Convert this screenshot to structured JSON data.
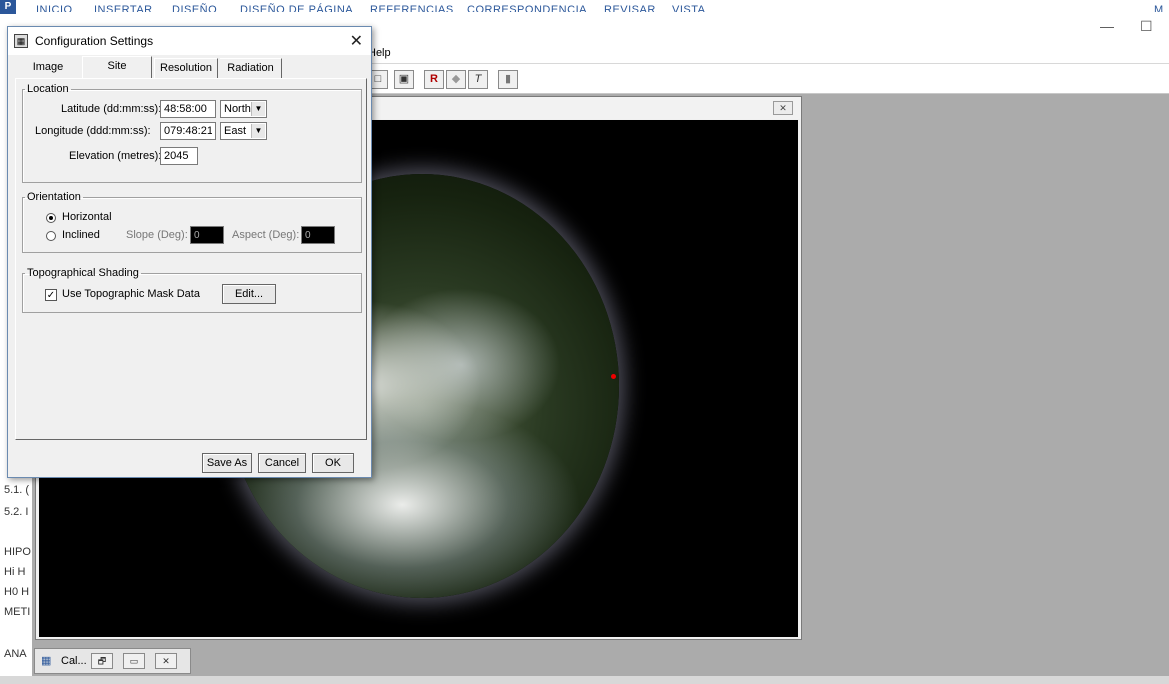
{
  "word_ribbon": {
    "icon": "P",
    "tabs": [
      "INICIO",
      "INSERTAR",
      "DISEÑO",
      "DISEÑO DE PÁGINA",
      "REFERENCIAS",
      "CORRESPONDENCIA",
      "REVISAR",
      "VISTA"
    ],
    "right_text": "M"
  },
  "word_left_strip": [
    "5.1. (",
    "5.2. I",
    "HIPO",
    "Hi H",
    "H0 H",
    "METI",
    "ANA"
  ],
  "app": {
    "menu_help": "Help",
    "minimize": "—",
    "maximize": "☐",
    "toolbar_icons": [
      "open-icon",
      "properties-icon",
      "red-tool-icon",
      "gray-tool-icon",
      "text-tool-icon",
      "bar-icon"
    ]
  },
  "image_window": {
    "close_glyph": "✕"
  },
  "minimized_child": {
    "label": "Cal...",
    "restore": "🗗",
    "maximize": "▭",
    "close": "✕"
  },
  "dialog": {
    "title": "Configuration Settings",
    "close": "✕",
    "tabs": [
      "Image",
      "Site",
      "Resolution",
      "Radiation"
    ],
    "active_tab": "Site",
    "location": {
      "legend": "Location",
      "latitude_label": "Latitude (dd:mm:ss):",
      "latitude_value": "48:58:00",
      "latitude_dir": "North",
      "longitude_label": "Longitude (ddd:mm:ss):",
      "longitude_value": "079:48:21",
      "longitude_dir": "East",
      "elevation_label": "Elevation (metres):",
      "elevation_value": "2045"
    },
    "orientation": {
      "legend": "Orientation",
      "horizontal": "Horizontal",
      "inclined": "Inclined",
      "slope_label": "Slope (Deg):",
      "slope_value": "0",
      "aspect_label": "Aspect (Deg):",
      "aspect_value": "0",
      "selected": "Horizontal"
    },
    "topo": {
      "legend": "Topographical Shading",
      "use_mask": "Use Topographic Mask Data",
      "use_mask_checked": true,
      "edit": "Edit..."
    },
    "buttons": {
      "save_as": "Save As",
      "cancel": "Cancel",
      "ok": "OK"
    }
  }
}
